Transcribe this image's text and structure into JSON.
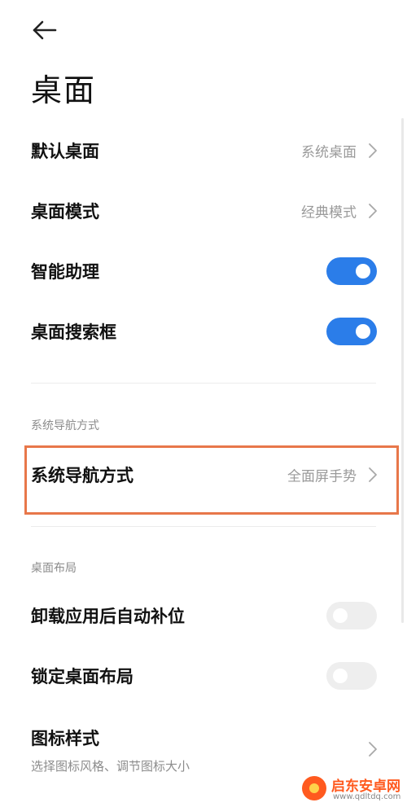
{
  "header": {
    "back_icon": "arrow-left-icon",
    "title": "桌面"
  },
  "settings": {
    "default_desktop": {
      "label": "默认桌面",
      "value": "系统桌面"
    },
    "desktop_mode": {
      "label": "桌面模式",
      "value": "经典模式"
    },
    "smart_assistant": {
      "label": "智能助理",
      "enabled": true
    },
    "desktop_search": {
      "label": "桌面搜索框",
      "enabled": true
    }
  },
  "nav_section": {
    "title": "系统导航方式",
    "item": {
      "label": "系统导航方式",
      "value": "全面屏手势"
    }
  },
  "layout_section": {
    "title": "桌面布局",
    "auto_fill": {
      "label": "卸载应用后自动补位",
      "enabled": false
    },
    "lock_layout": {
      "label": "锁定桌面布局",
      "enabled": false
    },
    "icon_style": {
      "label": "图标样式",
      "subtitle": "选择图标风格、调节图标大小"
    }
  },
  "colors": {
    "accent": "#2b7de9",
    "highlight": "#e8774a"
  },
  "watermark": {
    "name": "启东安卓网",
    "url": "www.qdltdq.com"
  }
}
